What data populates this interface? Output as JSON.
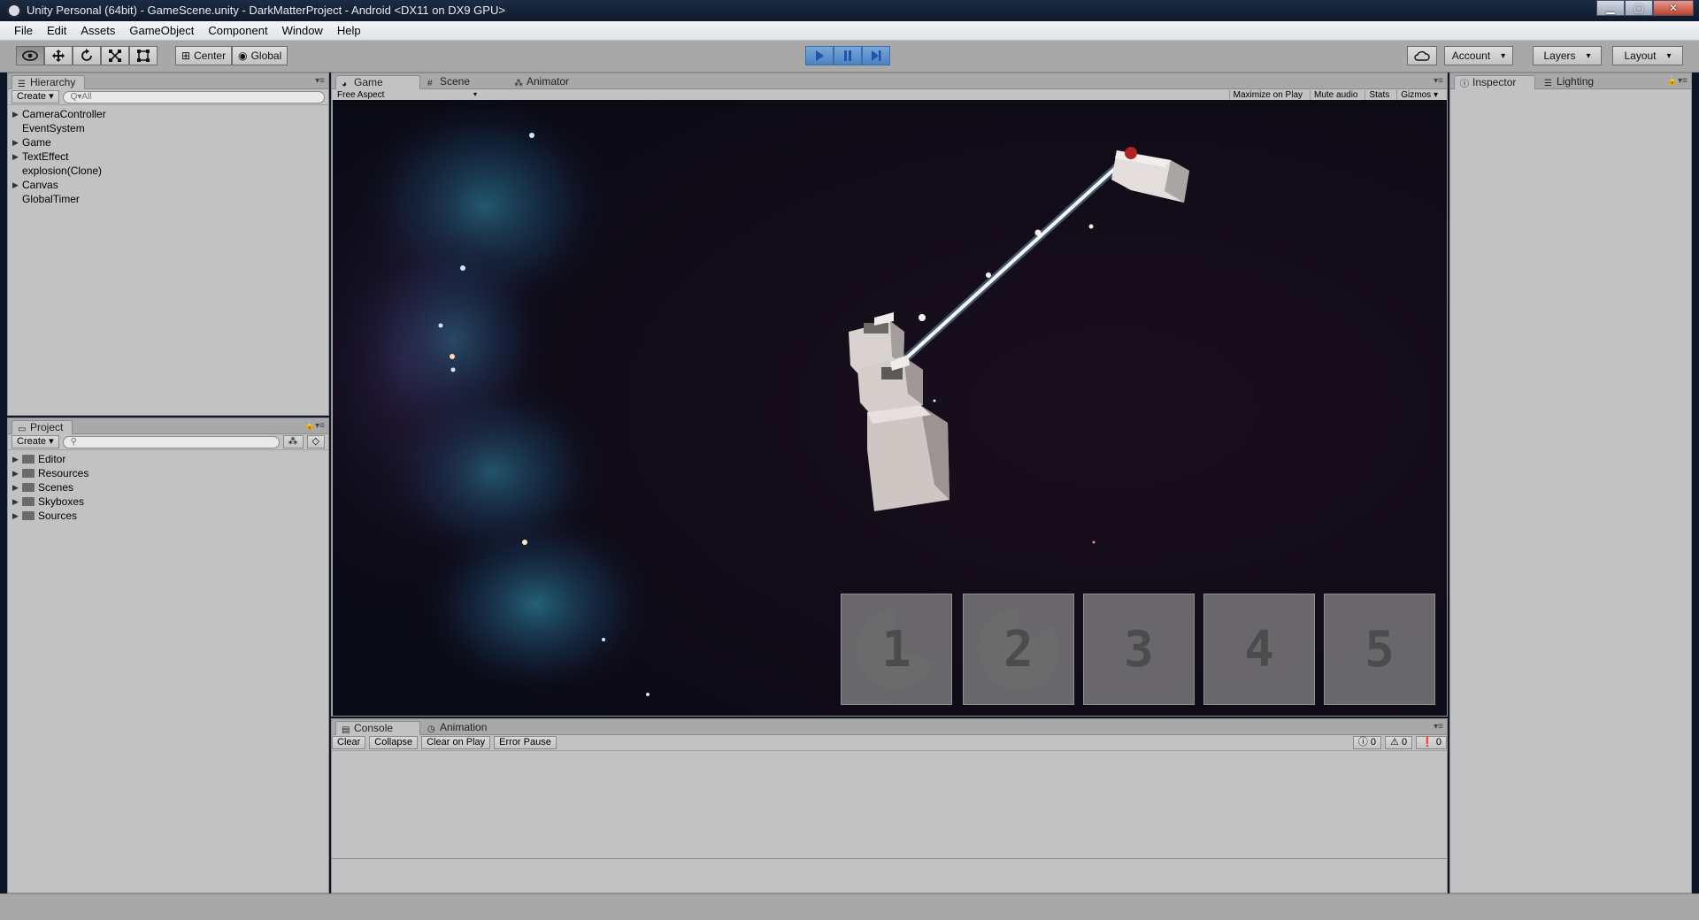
{
  "window": {
    "title": "Unity Personal (64bit) - GameScene.unity - DarkMatterProject - Android <DX11 on DX9 GPU>",
    "min_label": "▁",
    "max_label": "▢",
    "close_label": "✕"
  },
  "menu": [
    "File",
    "Edit",
    "Assets",
    "GameObject",
    "Component",
    "Window",
    "Help"
  ],
  "toolbar": {
    "tools": [
      "eye-icon",
      "move-icon",
      "rotate-icon",
      "scale-icon",
      "rect-icon"
    ],
    "center_label": "Center",
    "global_label": "Global",
    "account_label": "Account",
    "layers_label": "Layers",
    "layout_label": "Layout"
  },
  "hierarchy": {
    "tab_label": "Hierarchy",
    "create_label": "Create",
    "search_placeholder": "Q▾All",
    "items": [
      {
        "label": "CameraController",
        "expandable": true
      },
      {
        "label": "EventSystem",
        "expandable": false
      },
      {
        "label": "Game",
        "expandable": true
      },
      {
        "label": "TextEffect",
        "expandable": true
      },
      {
        "label": "explosion(Clone)",
        "expandable": false
      },
      {
        "label": "Canvas",
        "expandable": true
      },
      {
        "label": "GlobalTimer",
        "expandable": false
      }
    ]
  },
  "project": {
    "tab_label": "Project",
    "create_label": "Create",
    "folders": [
      "Editor",
      "Resources",
      "Scenes",
      "Skyboxes",
      "Sources"
    ]
  },
  "center_tabs": {
    "game": "Game",
    "scene": "Scene",
    "animator": "Animator"
  },
  "game_bar": {
    "aspect": "Free Aspect",
    "maximize": "Maximize on Play",
    "mute": "Mute audio",
    "stats": "Stats",
    "gizmos": "Gizmos"
  },
  "game_slots": [
    {
      "label": "1",
      "cooldown": 0.7
    },
    {
      "label": "2",
      "cooldown": 0.85
    },
    {
      "label": "3",
      "cooldown": 0
    },
    {
      "label": "4",
      "cooldown": 0
    },
    {
      "label": "5",
      "cooldown": 0
    }
  ],
  "right_tabs": {
    "inspector": "Inspector",
    "lighting": "Lighting"
  },
  "console": {
    "tab_label": "Console",
    "animation_tab": "Animation",
    "buttons": [
      "Clear",
      "Collapse",
      "Clear on Play",
      "Error Pause"
    ],
    "info_count": "0",
    "warning_count": "0",
    "error_count": "0"
  },
  "colors": {
    "play_accent": "#4c82c2",
    "beam": "#dff4ff",
    "enemy_core": "#b22222"
  }
}
